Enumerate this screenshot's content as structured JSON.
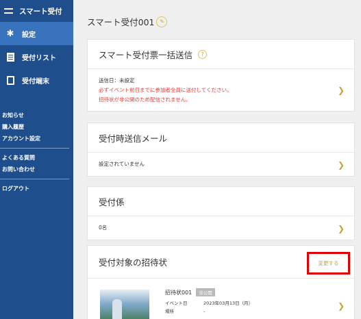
{
  "sidebar": {
    "brand": "スマート受付",
    "items": [
      {
        "label": "設定",
        "active": true,
        "icon": "gear-icon"
      },
      {
        "label": "受付リスト",
        "active": false,
        "icon": "list-icon"
      },
      {
        "label": "受付端末",
        "active": false,
        "icon": "terminal-icon"
      }
    ],
    "links": {
      "group1": [
        "お知らせ",
        "購入履歴",
        "アカウント設定"
      ],
      "group2": [
        "よくある質問",
        "お問い合わせ"
      ],
      "group3": [
        "ログアウト"
      ]
    }
  },
  "main": {
    "title": "スマート受付001",
    "cards": {
      "bulk_send": {
        "title": "スマート受付票一括送信",
        "lines": [
          {
            "text": "送信日：未設定",
            "color": "#333333"
          },
          {
            "text": "必ずイベント前日までに参加者全員に送付してください。",
            "color": "#e23c3c"
          },
          {
            "text": "招待状が非公開のため配信されません。",
            "color": "#e23c3c"
          }
        ]
      },
      "mail": {
        "title": "受付時送信メール",
        "body": "設定されていません"
      },
      "staff": {
        "title": "受付係",
        "body": "0名"
      },
      "invitation": {
        "title": "受付対象の招待状",
        "change_label": "変更する",
        "item": {
          "name": "招待状001",
          "badge": "非公開",
          "event_date_label": "イベント日",
          "event_date": "2023年03月13日（月）",
          "place_label": "場所",
          "place": "-"
        }
      }
    }
  },
  "colors": {
    "sidebar_bg": "#1f4e8c",
    "active_bg": "#3a73bd",
    "accent": "#c9a23a",
    "alert_red": "#e23c3c",
    "highlight_box": "#e00000"
  }
}
